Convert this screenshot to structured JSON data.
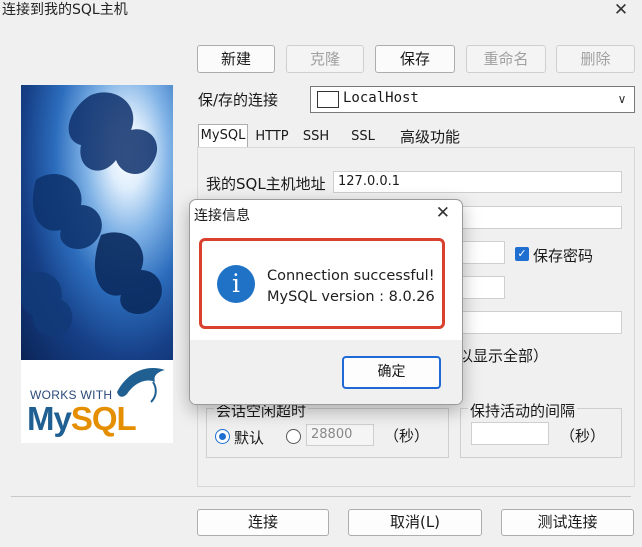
{
  "window": {
    "title": "连接到我的SQL主机",
    "close_glyph": "✕"
  },
  "banner": {
    "works_with": "WORKS WITH",
    "mysql_my": "My",
    "mysql_sql": "SQL"
  },
  "toolbar": {
    "new_label": "新建",
    "clone_label": "克隆",
    "save_label": "保存",
    "rename_label": "重命名",
    "delete_label": "删除"
  },
  "saved_connection": {
    "label": "保/存的连接",
    "value": "LocalHost",
    "arrow_glyph": "∨"
  },
  "tabs": [
    {
      "label": "MySQL",
      "active": true
    },
    {
      "label": "HTTP",
      "active": false
    },
    {
      "label": "SSH",
      "active": false
    },
    {
      "label": "SSL",
      "active": false
    },
    {
      "label": "高级功能",
      "active": false
    }
  ],
  "mysql_tab": {
    "host_label": "我的SQL主机地址",
    "host_value": "127.0.0.1",
    "save_password_label": "保存密码",
    "show_all_hint": "以显示全部）",
    "session_idle_label": "会话空闲超时",
    "default_label": "默认",
    "timeout_value": "28800",
    "seconds_label": "（秒）",
    "keepalive_label": "保持活动的间隔",
    "keepalive_seconds_label": "（秒）"
  },
  "footer": {
    "connect_label": "连接",
    "cancel_label": "取消(L)",
    "test_label": "测试连接"
  },
  "dialog": {
    "title": "连接信息",
    "close_glyph": "✕",
    "info_glyph": "i",
    "message_line1": "Connection successful!",
    "message_line2": "MySQL version : 8.0.26",
    "ok_label": "确定"
  },
  "colors": {
    "accent": "#1e6fd0",
    "highlight": "#d9412e",
    "brand_blue": "#1f5f91",
    "brand_orange": "#e48e00"
  }
}
